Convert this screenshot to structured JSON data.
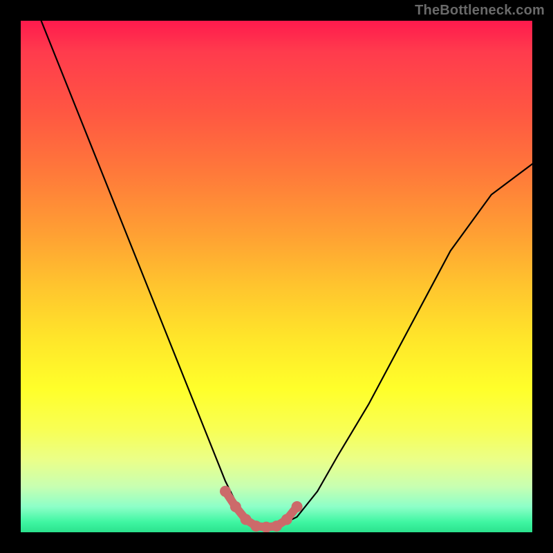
{
  "watermark": "TheBottleneck.com",
  "colors": {
    "accent": "#cc6a6a",
    "curve": "#000000",
    "gradient_top": "#ff1a4d",
    "gradient_bottom": "#2be28d"
  },
  "chart_data": {
    "type": "line",
    "title": "",
    "xlabel": "",
    "ylabel": "",
    "xlim": [
      0,
      100
    ],
    "ylim": [
      0,
      100
    ],
    "grid": false,
    "legend": false,
    "series": [
      {
        "name": "bottleneck-curve",
        "x": [
          0,
          4,
          8,
          12,
          16,
          20,
          24,
          28,
          32,
          36,
          40,
          42,
          44,
          46,
          48,
          50,
          54,
          58,
          62,
          68,
          76,
          84,
          92,
          100
        ],
        "y": [
          110,
          100,
          90,
          80,
          70,
          60,
          50,
          40,
          30,
          20,
          10,
          6,
          3,
          1,
          1,
          1,
          3,
          8,
          15,
          25,
          40,
          55,
          66,
          72
        ]
      }
    ],
    "annotations": [
      {
        "name": "trough-accent",
        "x": [
          40,
          42,
          44,
          46,
          48,
          50,
          52,
          54
        ],
        "y": [
          8,
          5,
          2.5,
          1.2,
          1.0,
          1.2,
          2.5,
          5
        ]
      }
    ]
  }
}
